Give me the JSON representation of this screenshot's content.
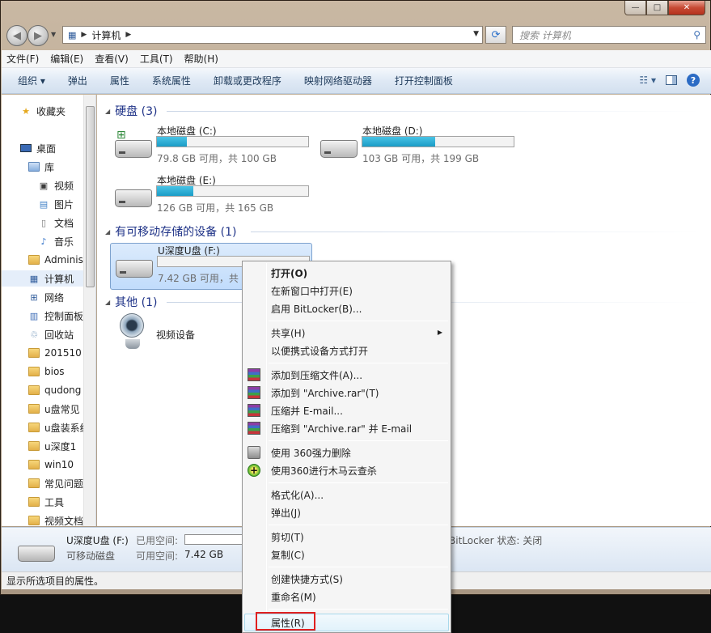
{
  "window": {
    "caption": {
      "minimize": "—",
      "maximize": "□",
      "close": "✕"
    }
  },
  "nav": {
    "back": "◀",
    "forward": "▶",
    "breadcrumb": [
      "计算机"
    ],
    "search_placeholder": "搜索 计算机"
  },
  "menubar": [
    "文件(F)",
    "编辑(E)",
    "查看(V)",
    "工具(T)",
    "帮助(H)"
  ],
  "toolbar": [
    "组织 ▾",
    "弹出",
    "属性",
    "系统属性",
    "卸载或更改程序",
    "映射网络驱动器",
    "打开控制面板"
  ],
  "sidebar": {
    "items": [
      {
        "label": "收藏夹",
        "icon": "star-icon"
      },
      {
        "label": "桌面",
        "icon": "desktop-icon"
      },
      {
        "label": "库",
        "icon": "library-icon"
      },
      {
        "label": "视频",
        "icon": "video-icon"
      },
      {
        "label": "图片",
        "icon": "picture-icon"
      },
      {
        "label": "文档",
        "icon": "document-icon"
      },
      {
        "label": "音乐",
        "icon": "music-icon"
      },
      {
        "label": "Adminis",
        "icon": "user-folder-icon"
      },
      {
        "label": "计算机",
        "icon": "computer-icon"
      },
      {
        "label": "网络",
        "icon": "network-icon"
      },
      {
        "label": "控制面板",
        "icon": "control-panel-icon"
      },
      {
        "label": "回收站",
        "icon": "recycle-bin-icon"
      },
      {
        "label": "201510",
        "icon": "folder-icon"
      },
      {
        "label": "bios",
        "icon": "folder-icon"
      },
      {
        "label": "qudong",
        "icon": "folder-icon"
      },
      {
        "label": "u盘常见",
        "icon": "folder-icon"
      },
      {
        "label": "u盘装系统",
        "icon": "folder-icon"
      },
      {
        "label": "u深度1",
        "icon": "folder-icon"
      },
      {
        "label": "win10",
        "icon": "folder-icon"
      },
      {
        "label": "常见问题",
        "icon": "folder-icon"
      },
      {
        "label": "工具",
        "icon": "folder-icon"
      },
      {
        "label": "视频文档",
        "icon": "folder-icon"
      }
    ]
  },
  "groups": {
    "hdd": "硬盘 (3)",
    "removable": "有可移动存储的设备 (1)",
    "other": "其他 (1)"
  },
  "drives": [
    {
      "name": "本地磁盘 (C:)",
      "info": "79.8 GB 可用，共 100 GB",
      "used_fraction": 0.2
    },
    {
      "name": "本地磁盘 (D:)",
      "info": "103 GB 可用，共 199 GB",
      "used_fraction": 0.48
    },
    {
      "name": "本地磁盘 (E:)",
      "info": "126 GB 可用，共 165 GB",
      "used_fraction": 0.24
    },
    {
      "name": "U深度U盘 (F:)",
      "info": "7.42 GB 可用，共 7",
      "used_fraction": 0.0
    }
  ],
  "other_device": "视频设备",
  "details": {
    "name": "U深度U盘 (F:)",
    "type": "可移动磁盘",
    "used_label": "已用空间:",
    "free_label": "可用空间:",
    "free_value": "7.42 GB",
    "bitlocker": "BitLocker 状态: 关闭"
  },
  "status": "显示所选项目的属性。",
  "context_menu": [
    "打开(O)",
    "在新窗口中打开(E)",
    "启用 BitLocker(B)...",
    "共享(H)",
    "以便携式设备方式打开",
    "添加到压缩文件(A)...",
    "添加到 \"Archive.rar\"(T)",
    "压缩并 E-mail...",
    "压缩到 \"Archive.rar\" 并 E-mail",
    "使用 360强力删除",
    "使用360进行木马云查杀",
    "格式化(A)...",
    "弹出(J)",
    "剪切(T)",
    "复制(C)",
    "创建快捷方式(S)",
    "重命名(M)",
    "属性(R)"
  ]
}
